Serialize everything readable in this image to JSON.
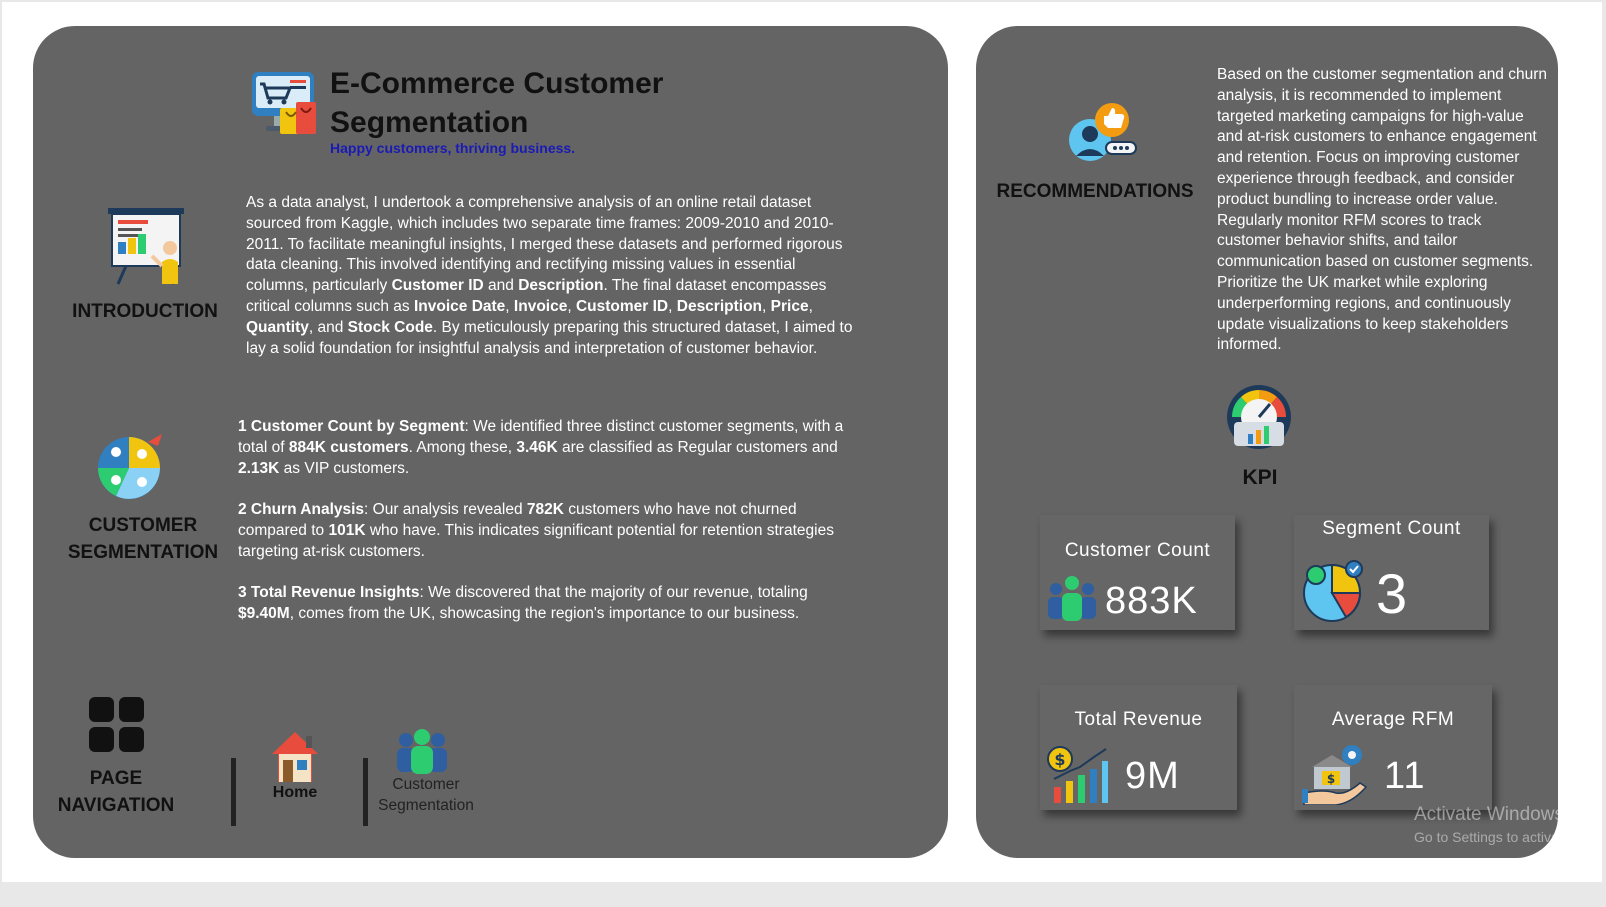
{
  "header": {
    "title": "E-Commerce Customer Segmentation",
    "tagline": "Happy customers, thriving business."
  },
  "introduction": {
    "label": "INTRODUCTION",
    "parts": [
      "As a data analyst, I undertook a comprehensive analysis of an online retail dataset sourced from Kaggle, which includes two separate time frames: 2009-2010 and 2010-2011. To facilitate meaningful insights, I merged these datasets and performed rigorous data cleaning. This involved identifying and rectifying missing values in essential columns, particularly ",
      "Customer ID",
      " and ",
      "Description",
      ". The final dataset encompasses critical columns such as ",
      "Invoice Date",
      ", ",
      "Invoice",
      ", ",
      "Customer ID",
      ", ",
      "Description",
      ", ",
      "Price",
      ", ",
      "Quantity",
      ", and ",
      "Stock Code",
      ". By meticulously preparing this structured dataset, I aimed to lay a solid foundation for insightful analysis and interpretation of customer behavior."
    ]
  },
  "segmentation": {
    "label_line1": "CUSTOMER",
    "label_line2": "SEGMENTATION",
    "p1": [
      "1 Customer Count by Segment",
      ": We identified three distinct customer segments, with a total of ",
      "884K customers",
      ". Among these, ",
      "3.46K",
      " are classified as Regular customers and ",
      "2.13K",
      " as VIP customers."
    ],
    "p2": [
      "2 Churn Analysis",
      ": Our analysis revealed ",
      "782K",
      " customers who have not churned compared to ",
      "101K",
      " who have. This indicates significant potential for retention strategies targeting at-risk customers."
    ],
    "p3": [
      "3 Total Revenue Insights",
      ": We discovered that the majority of our revenue, totaling ",
      "$9.40M",
      ", comes from the UK, showcasing the region's importance to our business."
    ]
  },
  "navigation": {
    "label_line1": "PAGE",
    "label_line2": "NAVIGATION",
    "home_label": "Home",
    "segment_label_line1": "Customer",
    "segment_label_line2": "Segmentation"
  },
  "recommendations": {
    "label": "RECOMMENDATIONS",
    "text": "Based on the customer segmentation and churn analysis, it is recommended to implement targeted marketing campaigns for high-value and at-risk customers to enhance engagement and retention. Focus on improving customer experience through feedback, and consider product bundling to increase order value. Regularly monitor RFM scores to track customer behavior shifts, and tailor communication based on customer segments. Prioritize the UK market while exploring underperforming regions, and continuously update visualizations to keep stakeholders informed."
  },
  "kpi": {
    "label": "KPI",
    "cards": {
      "customer_count": {
        "title": "Customer Count",
        "value": "883K",
        "icon": "people-icon"
      },
      "segment_count": {
        "title": "Segment Count",
        "value": "3",
        "icon": "pie-chart-icon"
      },
      "total_revenue": {
        "title": "Total Revenue",
        "value": "9M",
        "icon": "revenue-chart-icon"
      },
      "average_rfm": {
        "title": "Average RFM",
        "value": "11",
        "icon": "bank-hand-icon"
      }
    }
  },
  "watermark": {
    "line1": "Activate Windows",
    "line2": "Go to Settings to activate Windows."
  },
  "colors": {
    "panel": "#646464",
    "tagline": "#1a1ab4"
  }
}
